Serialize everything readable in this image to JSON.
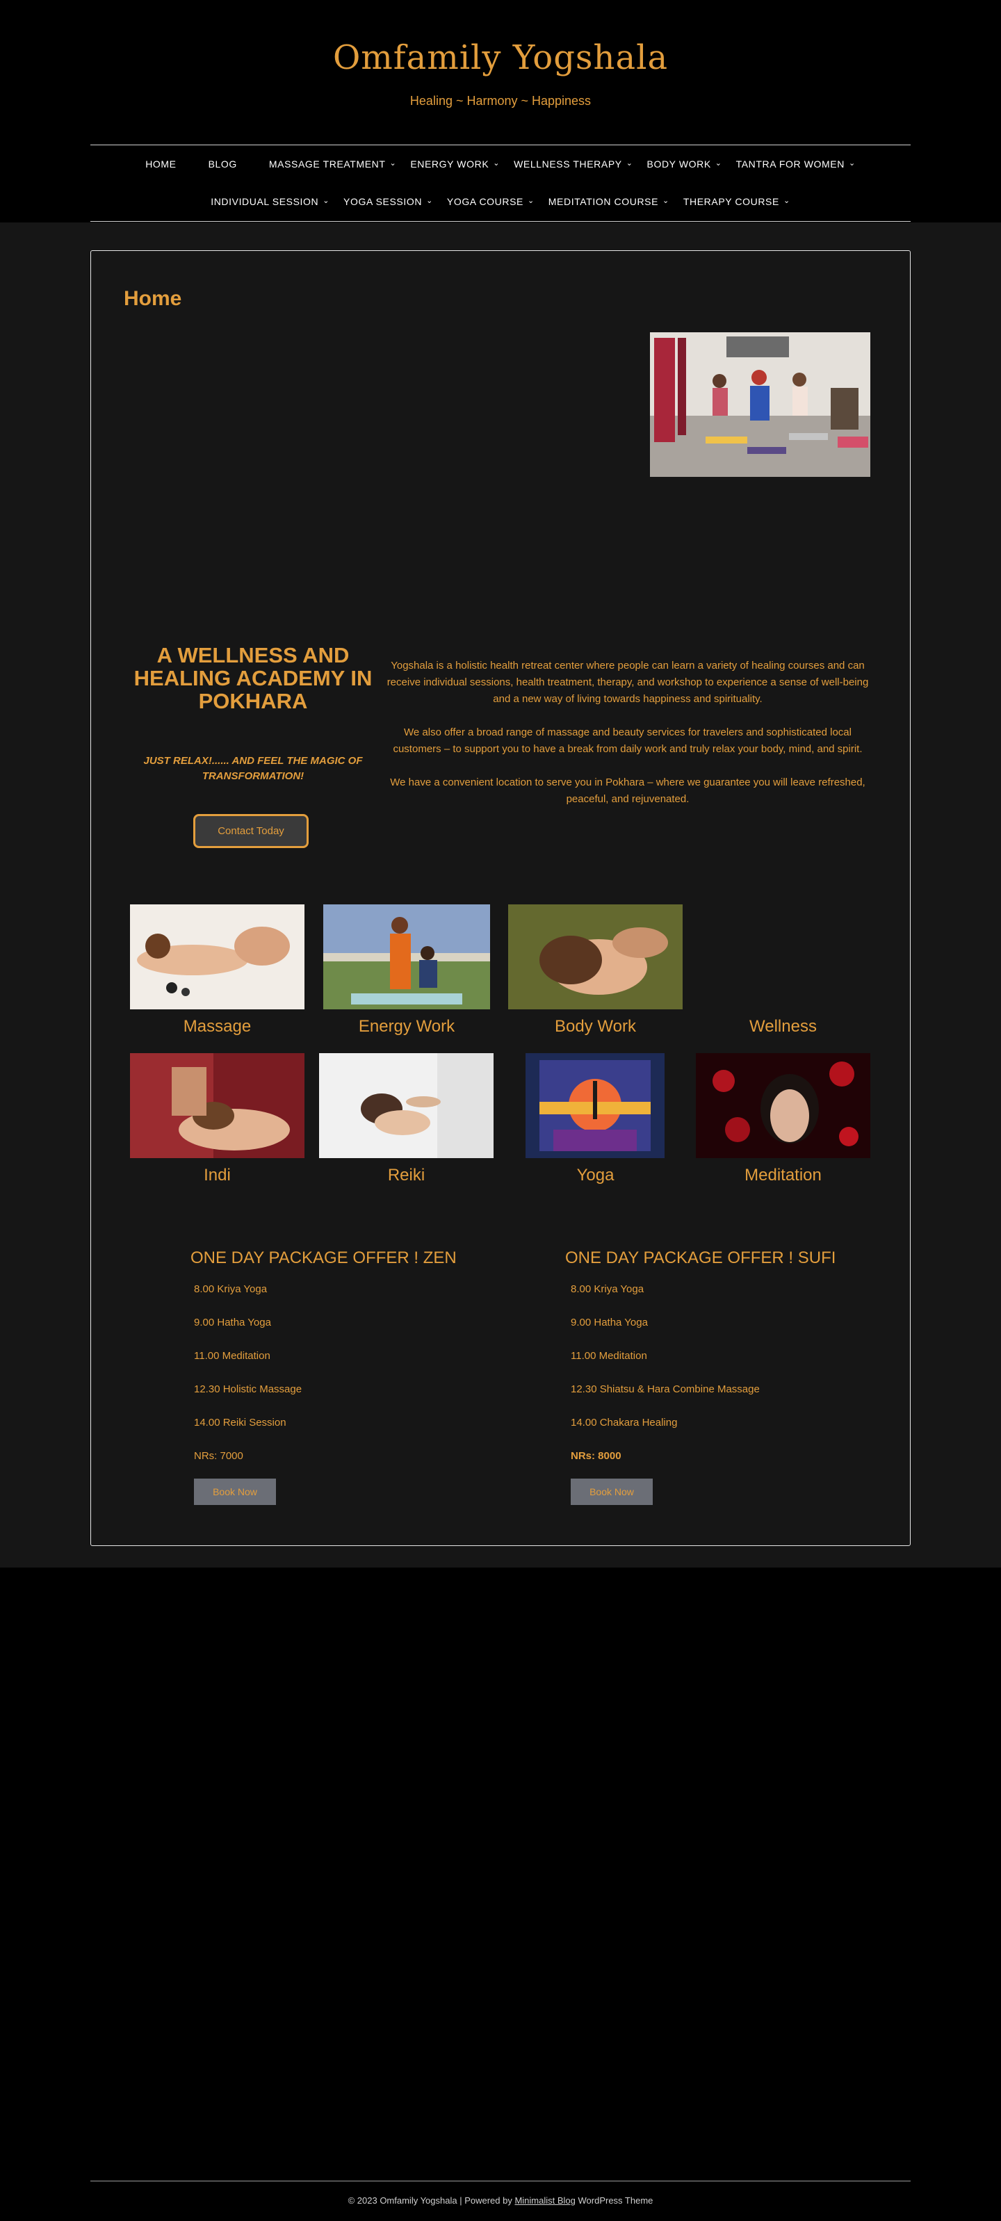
{
  "header": {
    "site_title": "Omfamily Yogshala",
    "tagline": "Healing ~ Harmony ~ Happiness"
  },
  "nav": {
    "row1": [
      {
        "label": "HOME",
        "dropdown": false
      },
      {
        "label": "BLOG",
        "dropdown": false
      },
      {
        "label": "MASSAGE TREATMENT",
        "dropdown": true
      },
      {
        "label": "ENERGY WORK",
        "dropdown": true
      },
      {
        "label": "WELLNESS THERAPY",
        "dropdown": true
      },
      {
        "label": "BODY WORK",
        "dropdown": true
      },
      {
        "label": "TANTRA FOR WOMEN",
        "dropdown": true
      }
    ],
    "row2": [
      {
        "label": "INDIVIDUAL SESSION",
        "dropdown": true
      },
      {
        "label": "YOGA SESSION",
        "dropdown": true
      },
      {
        "label": "YOGA COURSE",
        "dropdown": true
      },
      {
        "label": "MEDITATION COURSE",
        "dropdown": true
      },
      {
        "label": "THERAPY COURSE",
        "dropdown": true
      }
    ],
    "caret_icon": "chevron-down-icon"
  },
  "main": {
    "page_title": "Home",
    "academy_title": "A WELLNESS AND HEALING ACADEMY IN POKHARA",
    "relax_text": "JUST RELAX!...... AND FEEL THE MAGIC OF TRANSFORMATION!",
    "contact_button": "Contact Today",
    "intro": [
      "Yogshala is a holistic health retreat center where people can learn a variety of healing courses and can receive individual sessions, health treatment, therapy, and workshop to experience a sense of well-being and a new way of living towards happiness and spirituality.",
      "We also offer a broad range of massage and beauty services for travelers and sophisticated local customers – to support you to have a break from daily work and truly relax your body, mind, and spirit.",
      "We have a convenient location to serve you in Pokhara – where we guarantee you will leave refreshed, peaceful, and rejuvenated."
    ],
    "services": [
      {
        "label": "Massage"
      },
      {
        "label": "Energy Work"
      },
      {
        "label": "Body Work"
      },
      {
        "label": "Wellness"
      },
      {
        "label": "Indi"
      },
      {
        "label": "Reiki"
      },
      {
        "label": "Yoga"
      },
      {
        "label": "Meditation"
      }
    ],
    "packages": [
      {
        "title": "ONE DAY PACKAGE OFFER ! ZEN",
        "items": [
          "8.00 Kriya Yoga",
          "9.00 Hatha Yoga",
          "11.00 Meditation",
          "12.30 Holistic Massage",
          "14.00 Reiki Session"
        ],
        "price": "NRs: 7000",
        "button": "Book Now"
      },
      {
        "title": "ONE DAY PACKAGE OFFER ! SUFI",
        "items": [
          "8.00 Kriya Yoga",
          "9.00 Hatha Yoga",
          "11.00 Meditation",
          "12.30 Shiatsu & Hara Combine Massage",
          "14.00 Chakara Healing"
        ],
        "price": "NRs: 8000",
        "button": "Book Now"
      }
    ]
  },
  "footer": {
    "prefix": "© 2023 Omfamily Yogshala | Powered by ",
    "link": "Minimalist Blog",
    "suffix": " WordPress Theme"
  },
  "colors": {
    "accent": "#e39e3d",
    "page_bg": "#000000",
    "content_bg": "#161616",
    "button_grey": "#6b6e76"
  }
}
